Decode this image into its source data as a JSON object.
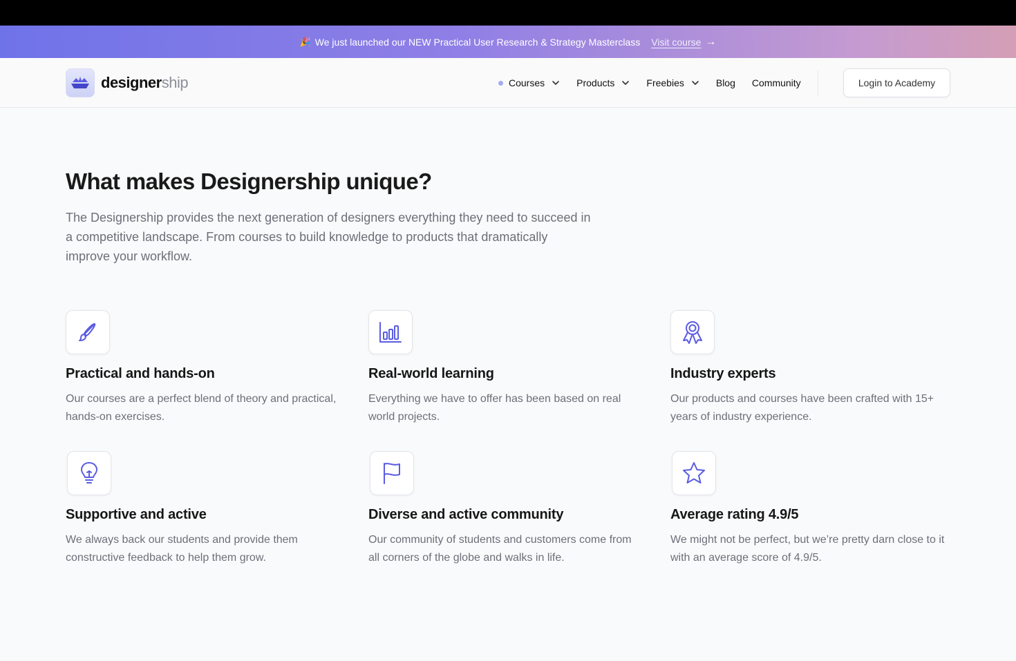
{
  "announcement": {
    "emoji": "🎉",
    "text": "We just launched our NEW Practical User Research & Strategy Masterclass",
    "link_label": "Visit course",
    "arrow": "→"
  },
  "header": {
    "logo_bold": "designer",
    "logo_light": "ship",
    "nav": [
      {
        "label": "Courses",
        "has_dropdown": true,
        "active_dot": true
      },
      {
        "label": "Products",
        "has_dropdown": true
      },
      {
        "label": "Freebies",
        "has_dropdown": true
      },
      {
        "label": "Blog",
        "has_dropdown": false
      },
      {
        "label": "Community",
        "has_dropdown": false
      }
    ],
    "login_label": "Login to Academy"
  },
  "main": {
    "title": "What makes Designership unique?",
    "intro": "The Designership provides the next generation of designers everything they need to succeed in a competitive landscape. From courses to build knowledge to products that dramatically improve your workflow.",
    "features": [
      {
        "icon": "paintbrush-icon",
        "title": "Practical and hands-on",
        "text": "Our courses are a perfect blend of theory and practical, hands-on exercises."
      },
      {
        "icon": "bar-chart-icon",
        "title": "Real-world learning",
        "text": "Everything we have to offer has been based on real world projects."
      },
      {
        "icon": "award-ribbon-icon",
        "title": "Industry experts",
        "text": "Our products and courses have been crafted with 15+ years of industry experience."
      },
      {
        "icon": "lightbulb-icon",
        "title": "Supportive and active",
        "text": "We always back our students and provide them constructive feedback to help them grow."
      },
      {
        "icon": "flag-icon",
        "title": "Diverse and active community",
        "text": "Our community of students and customers come from all corners of the globe and walks in life."
      },
      {
        "icon": "star-icon",
        "title": "Average rating 4.9/5",
        "text": "We might not be perfect, but we’re pretty darn close to it with an average score of 4.9/5."
      }
    ]
  },
  "colors": {
    "accent": "#5b5ce2",
    "banner_start": "#6f73e8",
    "banner_end": "#d49eb5"
  }
}
